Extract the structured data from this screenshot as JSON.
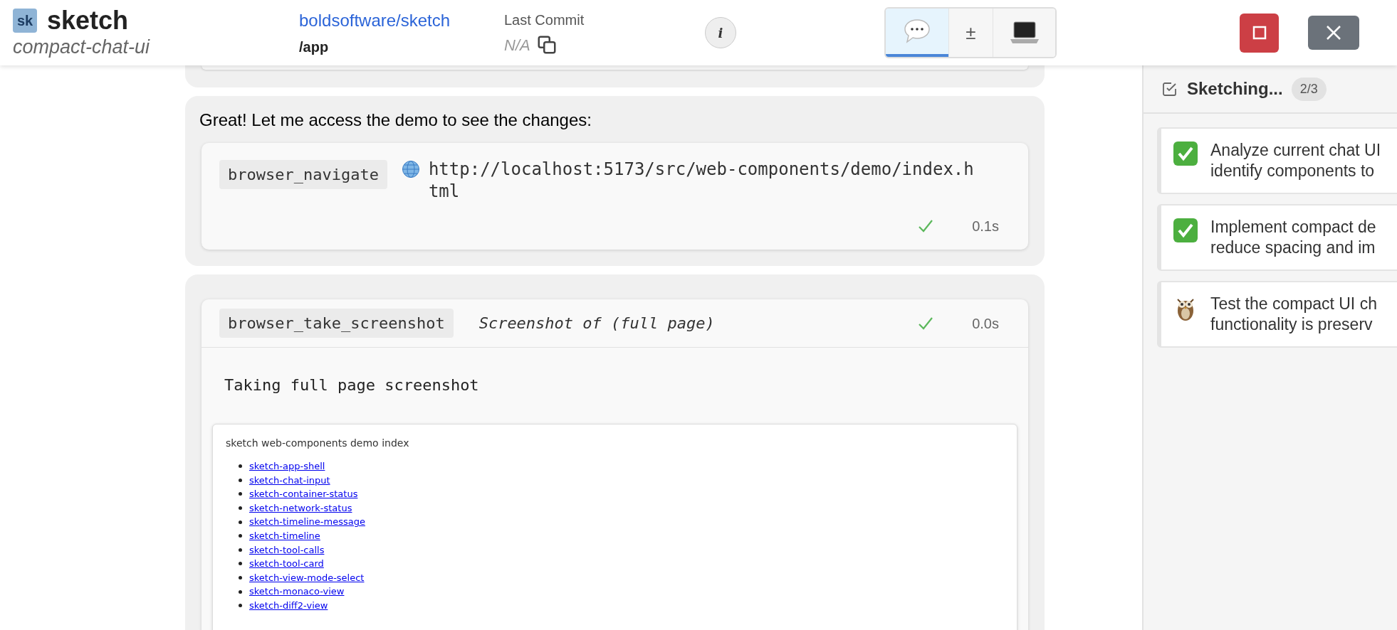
{
  "header": {
    "logo": "sk",
    "title": "sketch",
    "branch": "compact-chat-ui",
    "repo": "boldsoftware/sketch",
    "path": "/app",
    "commit_label": "Last Commit",
    "commit_value": "N/A",
    "info": "i"
  },
  "view_modes": [
    {
      "kind": "chat",
      "selected": true
    },
    {
      "kind": "diff",
      "label": "±",
      "selected": false
    },
    {
      "kind": "terminal",
      "selected": false
    }
  ],
  "messages": [
    {
      "text": "Great! Let me access the demo to see the changes:",
      "tool": {
        "name": "browser_navigate",
        "kind": "stacked",
        "detail": "http://localhost:5173/src/web-components/demo/index.html",
        "succeeded": true,
        "duration": "0.1s"
      }
    },
    {
      "tool": {
        "name": "browser_take_screenshot",
        "kind": "inline",
        "detail": "Screenshot of (full page)",
        "succeeded": true,
        "duration": "0.0s",
        "output": "Taking full page screenshot",
        "screenshot": {
          "title": "sketch web-components demo index",
          "links": [
            "sketch-app-shell",
            "sketch-chat-input",
            "sketch-container-status",
            "sketch-network-status",
            "sketch-timeline-message",
            "sketch-timeline",
            "sketch-tool-calls",
            "sketch-tool-card",
            "sketch-view-mode-select",
            "sketch-monaco-view",
            "sketch-diff2-view"
          ]
        }
      }
    }
  ],
  "todo": {
    "title": "Sketching...",
    "count": "2/3",
    "items": [
      {
        "kind": "completed",
        "lines": [
          "Analyze current chat UI",
          "identify components to"
        ]
      },
      {
        "kind": "completed",
        "lines": [
          "Implement compact de",
          "reduce spacing and im"
        ]
      },
      {
        "kind": "in_progress",
        "lines": [
          "Test the compact UI ch",
          "functionality is preserv"
        ]
      }
    ]
  }
}
